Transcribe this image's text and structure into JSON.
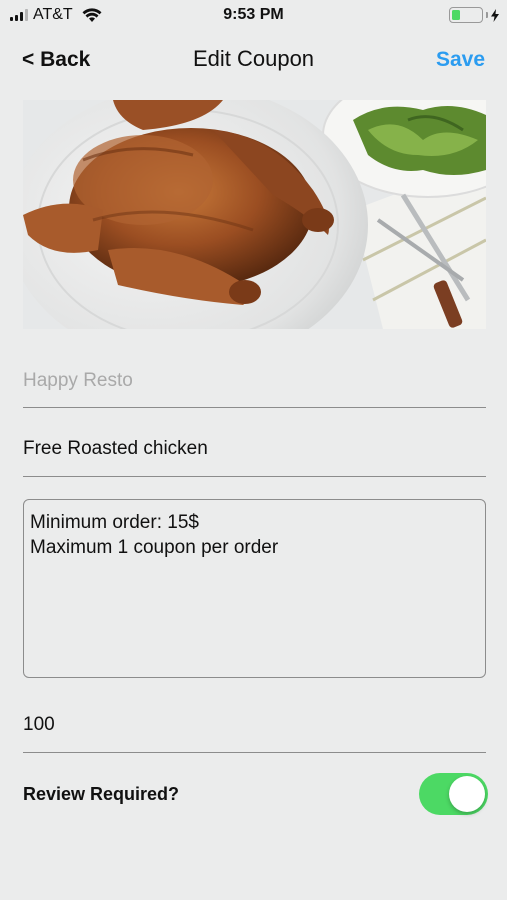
{
  "status_bar": {
    "carrier": "AT&T",
    "time": "9:53 PM",
    "battery_level": 0.3,
    "icons": [
      "signal-icon",
      "wifi-icon",
      "battery-icon",
      "charging-bolt-icon"
    ]
  },
  "nav": {
    "back_label": "< Back",
    "title": "Edit Coupon",
    "save_label": "Save"
  },
  "form": {
    "restaurant_placeholder": "Happy Resto",
    "restaurant_value": "",
    "coupon_title": "Free Roasted chicken",
    "description_lines": [
      "Minimum order: 15$",
      "Maximum 1 coupon per order"
    ],
    "quantity": "100",
    "review_label": "Review Required?",
    "review_required": true
  },
  "colors": {
    "accent": "#2b9cf0",
    "toggle_on": "#4cd964",
    "background": "#ebecec"
  }
}
